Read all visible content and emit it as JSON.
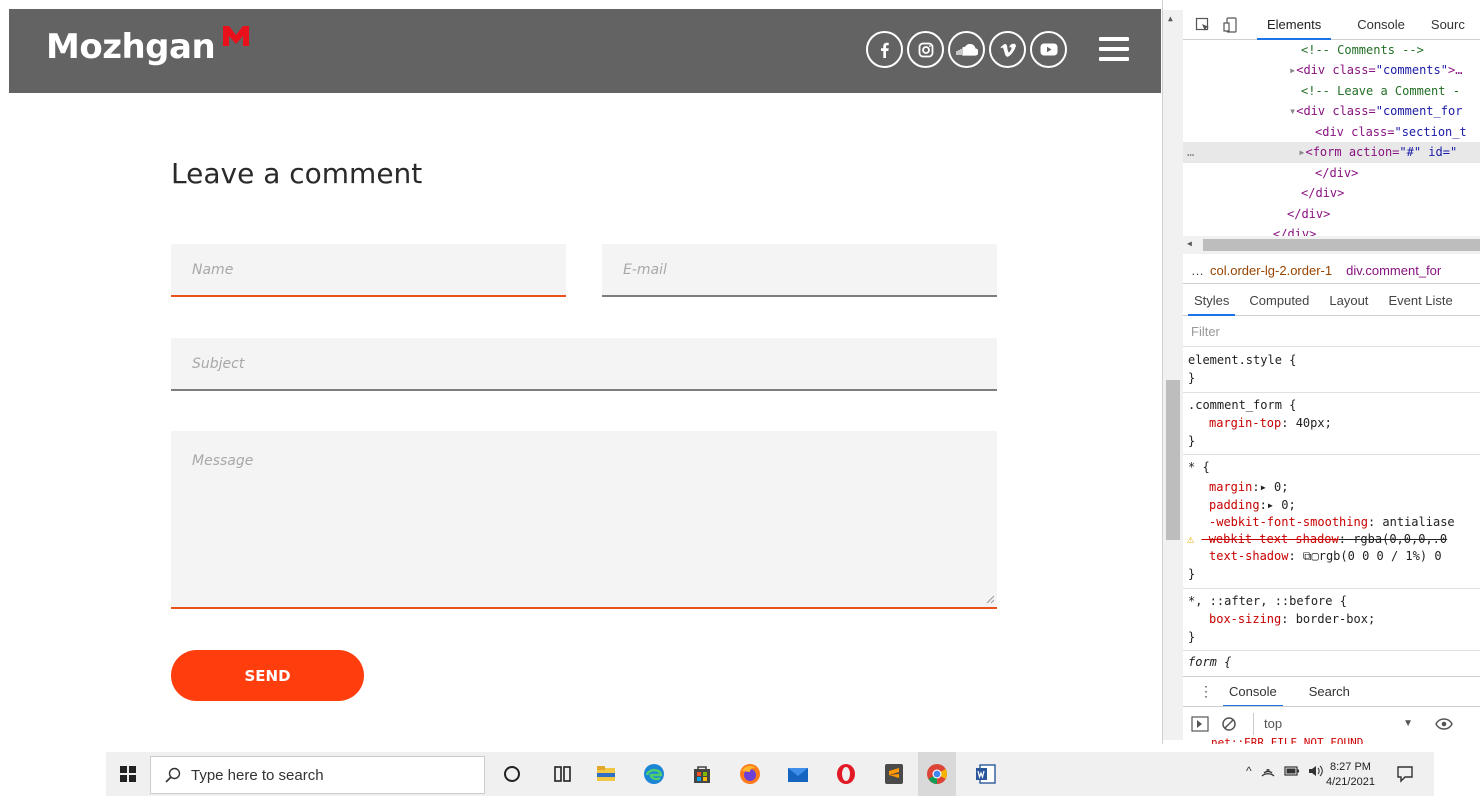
{
  "site": {
    "brand": "Mozhgan",
    "social_icons": [
      "facebook-icon",
      "instagram-icon",
      "soundcloud-icon",
      "vimeo-icon",
      "youtube-icon"
    ],
    "section_title": "Leave a comment",
    "form": {
      "name_placeholder": "Name",
      "email_placeholder": "E-mail",
      "subject_placeholder": "Subject",
      "message_placeholder": "Message",
      "send_label": "SEND"
    },
    "colors": {
      "header": "#636363",
      "accent": "#ff3d0d",
      "underline_active": "#e9521f"
    }
  },
  "devtools": {
    "tabs": [
      "Elements",
      "Console",
      "Sourc"
    ],
    "dom": {
      "l1": "<!-- Comments -->",
      "l2_tag": "<div class=",
      "l2_val": "\"comments\"",
      "l2_rest": ">…",
      "l3": "<!-- Leave a Comment -",
      "l4_tag": "<div class=",
      "l4_val": "\"comment_for",
      "l5_tag": "<div class=",
      "l5_val": "\"section_t",
      "l6_tag": "<form action=",
      "l6_val": "\"#\" id=\"",
      "l7": "</div>",
      "l8": "</div>",
      "l9": "</div>",
      "l10": "</div>",
      "dots": "…"
    },
    "breadcrumb": {
      "dots": "…",
      "first": "col.order-lg-2.order-1",
      "second": "div.comment_for"
    },
    "subtabs": [
      "Styles",
      "Computed",
      "Layout",
      "Event Liste"
    ],
    "filter_placeholder": "Filter",
    "styles": {
      "r1_sel": "element.style {",
      "r1_end": "}",
      "r2_sel": ".comment_form {",
      "r2_prop": "margin-top",
      "r2_val": ": 40px;",
      "r2_end": "}",
      "r3_sel": "* {",
      "r3_p1": "margin",
      "r3_v1": ":▸ 0;",
      "r3_p2": "padding",
      "r3_v2": ":▸ 0;",
      "r3_p3": "-webkit-font-smoothing",
      "r3_v3": ": antialiase",
      "r3_p4": "-webkit-text-shadow",
      "r3_v4": ": rgba(0,0,0,.0",
      "r3_p5": "text-shadow",
      "r3_v5": ": ⧉▢rgb(0 0 0 / 1%) 0",
      "r3_end": "}",
      "r4_sel": "*, ::after, ::before {",
      "r4_prop": "box-sizing",
      "r4_val": ": border-box;",
      "r4_end": "}",
      "r5_sel": "form {"
    },
    "drawer_tabs": [
      "Console",
      "Search"
    ],
    "console_context": "top",
    "error_text": "net::ERR_FILE_NOT_FOUND"
  },
  "taskbar": {
    "search_placeholder": "Type here to search",
    "time": "8:27 PM",
    "date": "4/21/2021"
  }
}
